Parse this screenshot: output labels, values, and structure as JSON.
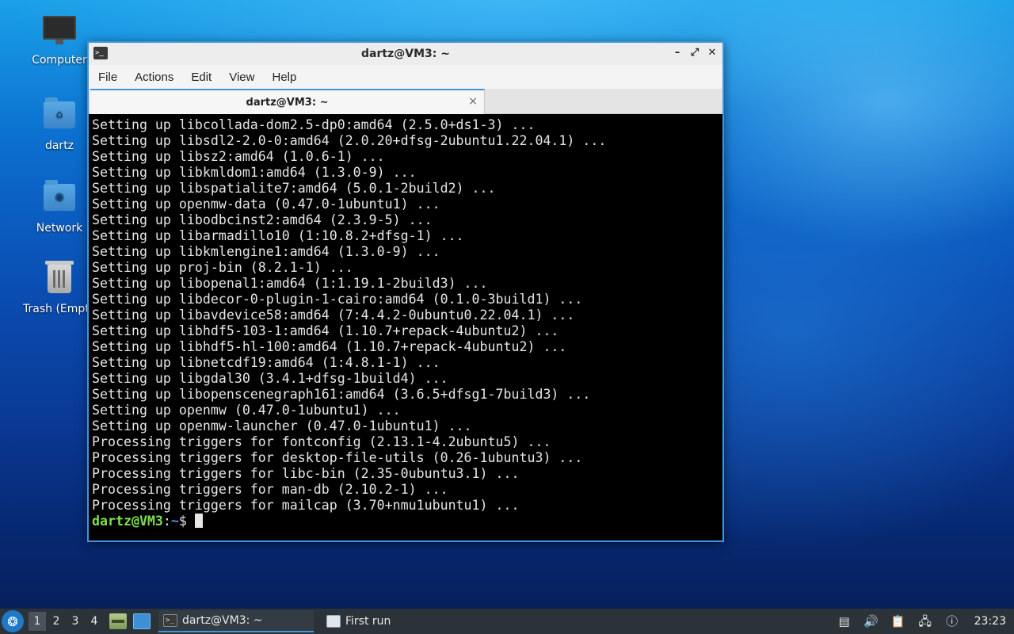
{
  "desktop": {
    "icons": [
      {
        "label": "Computer",
        "icon": "computer-icon"
      },
      {
        "label": "dartz",
        "icon": "home-folder-icon"
      },
      {
        "label": "Network",
        "icon": "network-folder-icon"
      },
      {
        "label": "Trash (Empty)",
        "icon": "trash-icon"
      }
    ]
  },
  "window": {
    "title": "dartz@VM3: ~",
    "menu": [
      "File",
      "Actions",
      "Edit",
      "View",
      "Help"
    ],
    "tab_label": "dartz@VM3: ~",
    "tab_close": "×",
    "controls": {
      "minimize": "–",
      "maximize": "⤢",
      "close": "✕"
    }
  },
  "terminal": {
    "lines": [
      "Setting up libcollada-dom2.5-dp0:amd64 (2.5.0+ds1-3) ...",
      "Setting up libsdl2-2.0-0:amd64 (2.0.20+dfsg-2ubuntu1.22.04.1) ...",
      "Setting up libsz2:amd64 (1.0.6-1) ...",
      "Setting up libkmldom1:amd64 (1.3.0-9) ...",
      "Setting up libspatialite7:amd64 (5.0.1-2build2) ...",
      "Setting up openmw-data (0.47.0-1ubuntu1) ...",
      "Setting up libodbcinst2:amd64 (2.3.9-5) ...",
      "Setting up libarmadillo10 (1:10.8.2+dfsg-1) ...",
      "Setting up libkmlengine1:amd64 (1.3.0-9) ...",
      "Setting up proj-bin (8.2.1-1) ...",
      "Setting up libopenal1:amd64 (1:1.19.1-2build3) ...",
      "Setting up libdecor-0-plugin-1-cairo:amd64 (0.1.0-3build1) ...",
      "Setting up libavdevice58:amd64 (7:4.4.2-0ubuntu0.22.04.1) ...",
      "Setting up libhdf5-103-1:amd64 (1.10.7+repack-4ubuntu2) ...",
      "Setting up libhdf5-hl-100:amd64 (1.10.7+repack-4ubuntu2) ...",
      "Setting up libnetcdf19:amd64 (1:4.8.1-1) ...",
      "Setting up libgdal30 (3.4.1+dfsg-1build4) ...",
      "Setting up libopenscenegraph161:amd64 (3.6.5+dfsg1-7build3) ...",
      "Setting up openmw (0.47.0-1ubuntu1) ...",
      "Setting up openmw-launcher (0.47.0-1ubuntu1) ...",
      "Processing triggers for fontconfig (2.13.1-4.2ubuntu5) ...",
      "Processing triggers for desktop-file-utils (0.26-1ubuntu3) ...",
      "Processing triggers for libc-bin (2.35-0ubuntu3.1) ...",
      "Processing triggers for man-db (2.10.2-1) ...",
      "Processing triggers for mailcap (3.70+nmu1ubuntu1) ..."
    ],
    "prompt_user": "dartz@VM3",
    "prompt_sep": ":",
    "prompt_path": "~",
    "prompt_symbol": "$",
    "colors": {
      "user": "#7fe04a",
      "path": "#5b8ff0",
      "text": "#e6e6e6",
      "background": "#000000"
    }
  },
  "taskbar": {
    "workspaces": [
      "1",
      "2",
      "3",
      "4"
    ],
    "active_workspace": "1",
    "tasks": [
      {
        "label": "dartz@VM3: ~",
        "icon": "terminal-icon"
      },
      {
        "label": "First run",
        "icon": "window-icon"
      }
    ],
    "clock": "23:23",
    "tray_icons": [
      "bar-icon",
      "volume-icon",
      "clipboard-icon",
      "network-icon",
      "update-notifier-icon"
    ],
    "accent": "#3d97e0"
  }
}
